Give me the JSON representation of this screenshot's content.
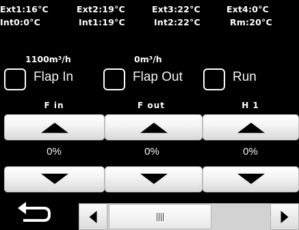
{
  "sensors": {
    "row1": [
      "Ext1:16°C",
      "Ext2:19°C",
      "Ext3:22°C",
      "Ext4:0°C"
    ],
    "row2": [
      "Int0:0°C",
      "Int1:19°C",
      "Int2:22°C",
      "Rm:20°C"
    ]
  },
  "flows": {
    "flap_in": "1100m³/h",
    "flap_out": "0m³/h"
  },
  "toggles": {
    "flap_in": "Flap In",
    "flap_out": "Flap Out",
    "run": "Run"
  },
  "columns": [
    {
      "label": "F in",
      "value": "0%"
    },
    {
      "label": "F out",
      "value": "0%"
    },
    {
      "label": "H 1",
      "value": "0%"
    }
  ],
  "icons": {
    "back": "back-arrow-icon",
    "up": "triangle-up-icon",
    "down": "triangle-down-icon",
    "scroll_left": "scroll-left-icon",
    "scroll_right": "scroll-right-icon"
  },
  "colors": {
    "background": "#000000",
    "text": "#ffffff",
    "button": "#f0f0f0"
  }
}
